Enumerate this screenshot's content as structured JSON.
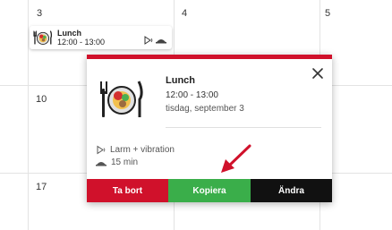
{
  "calendar": {
    "day_numbers": [
      "3",
      "4",
      "5",
      "10",
      "17"
    ]
  },
  "event_chip": {
    "title": "Lunch",
    "time": "12:00 - 13:00"
  },
  "popup": {
    "title": "Lunch",
    "time": "12:00 - 13:00",
    "date": "tisdag, september 3",
    "alarm": "Larm + vibration",
    "duration": "15 min",
    "accent_color": "#d0112b"
  },
  "actions": {
    "delete_label": "Ta bort",
    "copy_label": "Kopiera",
    "edit_label": "Ändra",
    "delete_color": "#d0112b",
    "copy_color": "#3aae4a",
    "edit_color": "#111111"
  },
  "annotation": {
    "arrow_color": "#d0112b",
    "icon": "arrow-pointer-icon"
  }
}
